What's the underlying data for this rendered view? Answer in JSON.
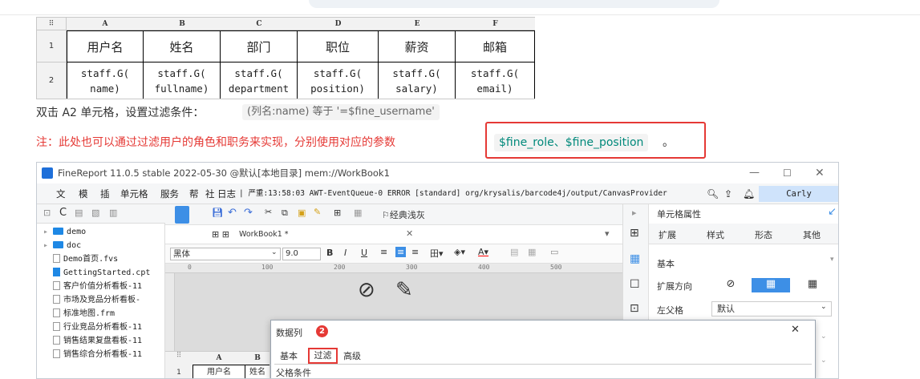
{
  "sheet": {
    "col_headers": [
      "A",
      "B",
      "C",
      "D",
      "E",
      "F"
    ],
    "row_headers": [
      "1",
      "2"
    ],
    "corner": "⠿",
    "row1": [
      "用户名",
      "姓名",
      "部门",
      "职位",
      "薪资",
      "邮箱"
    ],
    "row2": [
      "staff.G(\nname)",
      "staff.G(\nfullname)",
      "staff.G(\ndepartment",
      "staff.G(\nposition)",
      "staff.G(\nsalary)",
      "staff.G(\nemail)"
    ]
  },
  "note1": {
    "text": "双击 A2 单元格，设置过滤条件：",
    "code": "(列名:name) 等于 '=$fine_username'"
  },
  "note2": {
    "text": "注：此处也可以通过过滤用户的角色和职务来实现，分别使用对应的参数",
    "code": "$fine_role、$fine_position",
    "tail": "。"
  },
  "app": {
    "title": "FineReport 11.0.5 stable 2022-05-30 @默认[本地目录]    mem://WorkBook1",
    "menu": [
      "文",
      "模",
      "插",
      "单元格",
      "服务",
      "帮",
      "社",
      "日志"
    ],
    "log": "| 严重:13:58:03 AWT-EventQueue-0 ERROR [standard] org/krysalis/barcode4j/output/CanvasProvider",
    "user": "Carly",
    "theme": "经典浅灰",
    "tab": "WorkBook1 *",
    "font": "黑体",
    "font_size": "9.0",
    "ruler": [
      "0",
      "100",
      "200",
      "300",
      "400",
      "500"
    ],
    "tree": [
      {
        "name": "demo",
        "type": "folder"
      },
      {
        "name": "doc",
        "type": "folder"
      },
      {
        "name": "Demo首页.fvs",
        "type": "file"
      },
      {
        "name": "GettingStarted.cpt",
        "type": "file"
      },
      {
        "name": "客户价值分析看板-11",
        "type": "file"
      },
      {
        "name": "市场及竞品分析看板-",
        "type": "file"
      },
      {
        "name": "标准地图.frm",
        "type": "file"
      },
      {
        "name": "行业竞品分析看板-11",
        "type": "file"
      },
      {
        "name": "销售结果复盘看板-11",
        "type": "file"
      },
      {
        "name": "销售综合分析看板-11",
        "type": "file"
      }
    ],
    "right_panel": {
      "title": "单元格属性",
      "tabs": [
        "扩展",
        "样式",
        "形态",
        "其他"
      ],
      "section": "基本",
      "expand_label": "扩展方向",
      "parent_label": "左父格",
      "parent_value": "默认"
    },
    "mini_sheet": {
      "cols": [
        "A",
        "B"
      ],
      "row": "1",
      "cells": [
        "用户名",
        "姓名"
      ]
    },
    "dialog": {
      "title": "数据列",
      "badge": "2",
      "tabs": [
        "基本",
        "过滤",
        "高级"
      ],
      "parent_cond": "父格条件"
    }
  }
}
